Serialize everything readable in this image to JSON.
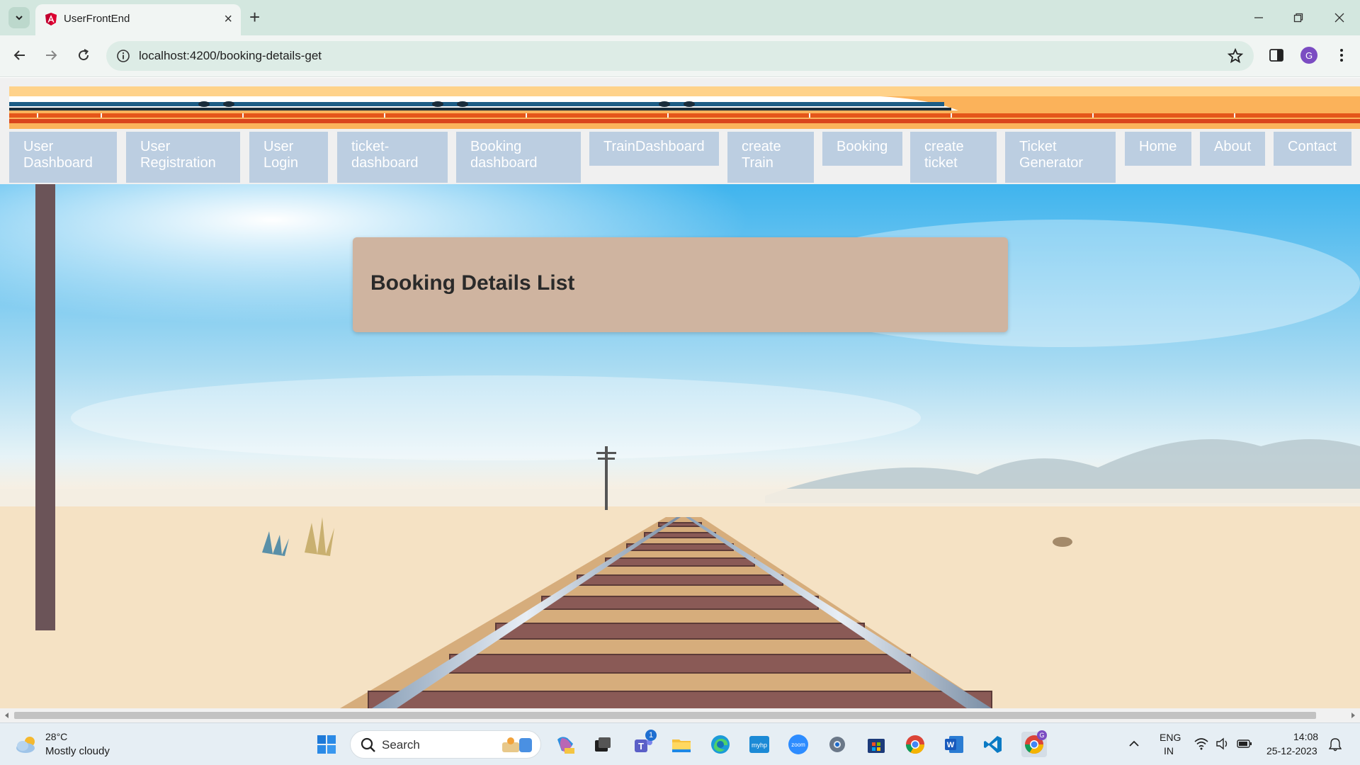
{
  "browser": {
    "tab_title": "UserFrontEnd",
    "url": "localhost:4200/booking-details-get",
    "profile_initial": "G"
  },
  "nav": {
    "items": [
      {
        "line1": "User",
        "line2": "Dashboard"
      },
      {
        "line1": "User",
        "line2": "Registration"
      },
      {
        "line1": "User",
        "line2": "Login"
      },
      {
        "line1": "ticket-",
        "line2": "dashboard"
      },
      {
        "line1": "Booking",
        "line2": "dashboard"
      },
      {
        "line1": "TrainDashboard",
        "line2": ""
      },
      {
        "line1": "create",
        "line2": "Train"
      },
      {
        "line1": "Booking",
        "line2": ""
      },
      {
        "line1": "create",
        "line2": "ticket"
      },
      {
        "line1": "Ticket",
        "line2": "Generator"
      },
      {
        "line1": "Home",
        "line2": ""
      },
      {
        "line1": "About",
        "line2": ""
      },
      {
        "line1": "Contact",
        "line2": ""
      }
    ]
  },
  "main": {
    "card_title": "Booking Details List"
  },
  "taskbar": {
    "weather_temp": "28°C",
    "weather_desc": "Mostly cloudy",
    "search_label": "Search",
    "teams_badge": "1",
    "lang_line1": "ENG",
    "lang_line2": "IN",
    "time": "14:08",
    "date": "25-12-2023"
  },
  "colors": {
    "nav_bg": "#bccee1",
    "card_bg": "#cfb4a0",
    "tabbar_bg": "#d3e7df",
    "banner_orange": "#fbb25a"
  }
}
